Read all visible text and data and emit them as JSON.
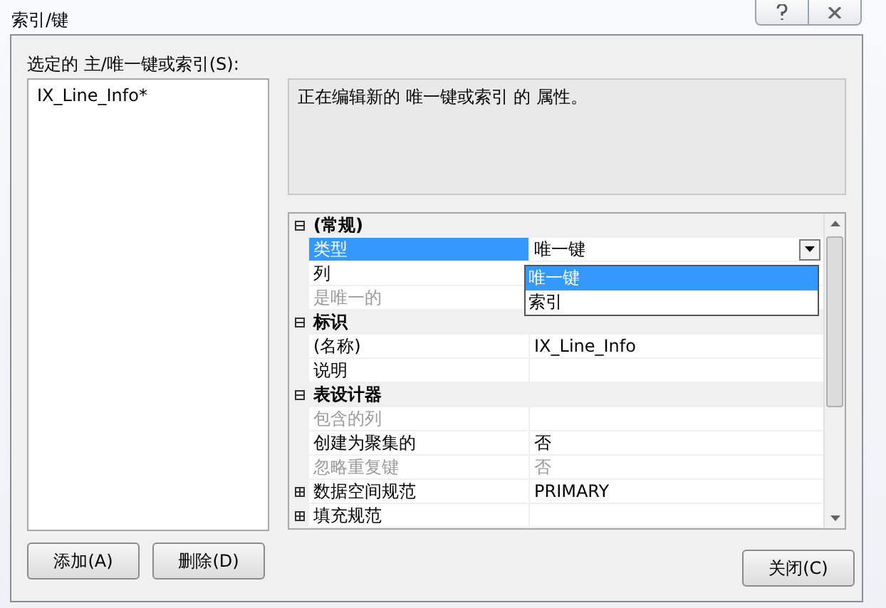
{
  "window": {
    "title": "索引/键"
  },
  "list_label": "选定的 主/唯一键或索引(S):",
  "indexes": [
    {
      "label": "IX_Line_Info*",
      "selected": false
    }
  ],
  "description": "正在编辑新的 唯一键或索引 的 属性。",
  "properties": [
    {
      "kind": "category",
      "label": "(常规)",
      "expanded": true
    },
    {
      "kind": "property",
      "label": "类型",
      "value": "唯一键",
      "selected": true,
      "disabled": false
    },
    {
      "kind": "property",
      "label": "列",
      "selected": false,
      "disabled": false
    },
    {
      "kind": "property",
      "label": "是唯一的",
      "selected": false,
      "disabled": true
    },
    {
      "kind": "category",
      "label": "标识",
      "expanded": true
    },
    {
      "kind": "property",
      "label": "(名称)",
      "value": "IX_Line_Info",
      "selected": false,
      "disabled": false
    },
    {
      "kind": "property",
      "label": "说明",
      "selected": false,
      "disabled": false
    },
    {
      "kind": "category",
      "label": "表设计器",
      "expanded": true
    },
    {
      "kind": "property",
      "label": "包含的列",
      "selected": false,
      "disabled": true
    },
    {
      "kind": "property",
      "label": "创建为聚集的",
      "value": "否",
      "selected": false,
      "disabled": false
    },
    {
      "kind": "property",
      "label": "忽略重复键",
      "value": "否",
      "selected": false,
      "disabled": true
    },
    {
      "kind": "group",
      "label": "数据空间规范",
      "value": "PRIMARY",
      "expanded": false
    },
    {
      "kind": "group",
      "label": "填充规范",
      "expanded": false
    }
  ],
  "dropdown": {
    "options": [
      {
        "label": "唯一键",
        "selected": true
      },
      {
        "label": "索引",
        "selected": false
      }
    ]
  },
  "buttons": [
    "添加(A)",
    "删除(D)"
  ],
  "close_button": "关闭(C)"
}
